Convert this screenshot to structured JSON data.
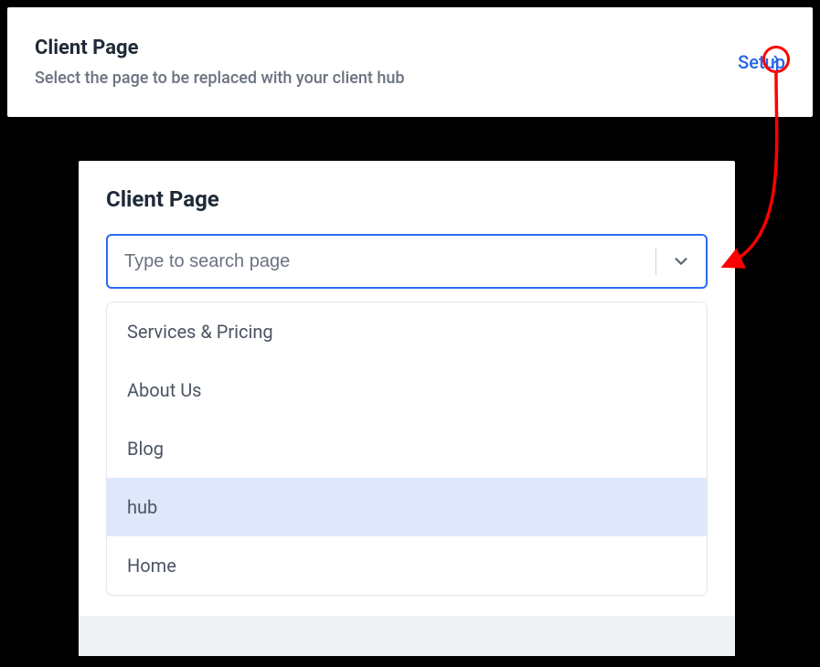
{
  "header": {
    "title": "Client Page",
    "subtitle": "Select the page to be replaced with your client hub",
    "setup_label": "Setup"
  },
  "panel": {
    "title": "Client Page",
    "search_placeholder": "Type to search page",
    "options": [
      {
        "label": "Services & Pricing",
        "highlight": false
      },
      {
        "label": "About Us",
        "highlight": false
      },
      {
        "label": "Blog",
        "highlight": false
      },
      {
        "label": "hub",
        "highlight": true
      },
      {
        "label": "Home",
        "highlight": false
      }
    ]
  },
  "colors": {
    "accent": "#2a6bf2",
    "callout": "#ff0000"
  }
}
